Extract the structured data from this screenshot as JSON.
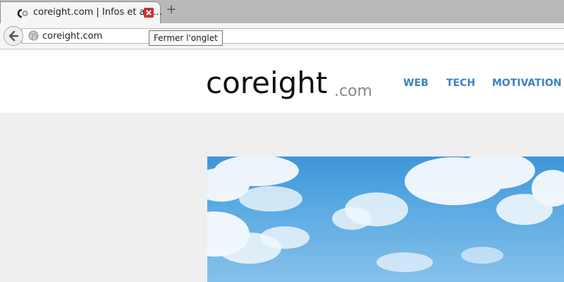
{
  "browser": {
    "tab": {
      "title": "coreight.com | Infos et ast..."
    },
    "new_tab_symbol": "+",
    "url": "coreight.com",
    "tooltip": "Fermer l'onglet"
  },
  "site": {
    "logo": {
      "main": "coreight",
      "suffix": ".com"
    },
    "nav": [
      {
        "label": "WEB"
      },
      {
        "label": "TECH"
      },
      {
        "label": "MOTIVATION"
      }
    ]
  },
  "icons": {
    "favicon": "coreight-favicon-icon",
    "close": "close-tab-icon",
    "back": "back-arrow-icon",
    "site_identity": "globe-icon"
  },
  "colors": {
    "accent_nav": "#3a82c4",
    "close_button": "#d32f2f",
    "sky": "#5aaae2"
  }
}
